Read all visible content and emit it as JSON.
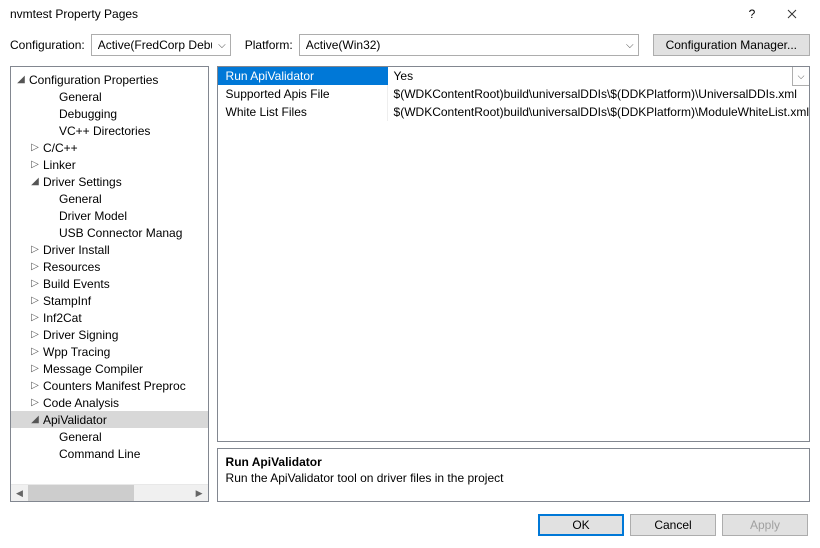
{
  "window": {
    "title": "nvmtest Property Pages",
    "help_label": "?",
    "close_label": "✕"
  },
  "toolbar": {
    "configuration_label": "Configuration:",
    "configuration_value": "Active(FredCorp Debug)",
    "platform_label": "Platform:",
    "platform_value": "Active(Win32)",
    "config_manager_label": "Configuration Manager..."
  },
  "tree": {
    "root": "Configuration Properties",
    "items": [
      {
        "label": "General",
        "indent": 2,
        "exp": ""
      },
      {
        "label": "Debugging",
        "indent": 2,
        "exp": ""
      },
      {
        "label": "VC++ Directories",
        "indent": 2,
        "exp": ""
      },
      {
        "label": "C/C++",
        "indent": 1,
        "exp": "▷"
      },
      {
        "label": "Linker",
        "indent": 1,
        "exp": "▷"
      },
      {
        "label": "Driver Settings",
        "indent": 1,
        "exp": "◢"
      },
      {
        "label": "General",
        "indent": 2,
        "exp": ""
      },
      {
        "label": "Driver Model",
        "indent": 2,
        "exp": ""
      },
      {
        "label": "USB Connector Manag",
        "indent": 2,
        "exp": ""
      },
      {
        "label": "Driver Install",
        "indent": 1,
        "exp": "▷"
      },
      {
        "label": "Resources",
        "indent": 1,
        "exp": "▷"
      },
      {
        "label": "Build Events",
        "indent": 1,
        "exp": "▷"
      },
      {
        "label": "StampInf",
        "indent": 1,
        "exp": "▷"
      },
      {
        "label": "Inf2Cat",
        "indent": 1,
        "exp": "▷"
      },
      {
        "label": "Driver Signing",
        "indent": 1,
        "exp": "▷"
      },
      {
        "label": "Wpp Tracing",
        "indent": 1,
        "exp": "▷"
      },
      {
        "label": "Message Compiler",
        "indent": 1,
        "exp": "▷"
      },
      {
        "label": "Counters Manifest Preproc",
        "indent": 1,
        "exp": "▷"
      },
      {
        "label": "Code Analysis",
        "indent": 1,
        "exp": "▷"
      },
      {
        "label": "ApiValidator",
        "indent": 1,
        "exp": "◢",
        "selected": true
      },
      {
        "label": "General",
        "indent": 2,
        "exp": ""
      },
      {
        "label": "Command Line",
        "indent": 2,
        "exp": ""
      }
    ]
  },
  "grid": {
    "rows": [
      {
        "name": "Run ApiValidator",
        "value": "Yes",
        "selected": true,
        "dropdown": true
      },
      {
        "name": "Supported Apis File",
        "value": "$(WDKContentRoot)build\\universalDDIs\\$(DDKPlatform)\\UniversalDDIs.xml"
      },
      {
        "name": "White List Files",
        "value": "$(WDKContentRoot)build\\universalDDIs\\$(DDKPlatform)\\ModuleWhiteList.xml"
      }
    ]
  },
  "description": {
    "title": "Run ApiValidator",
    "body": "Run the ApiValidator tool on driver files in the project"
  },
  "footer": {
    "ok": "OK",
    "cancel": "Cancel",
    "apply": "Apply"
  }
}
